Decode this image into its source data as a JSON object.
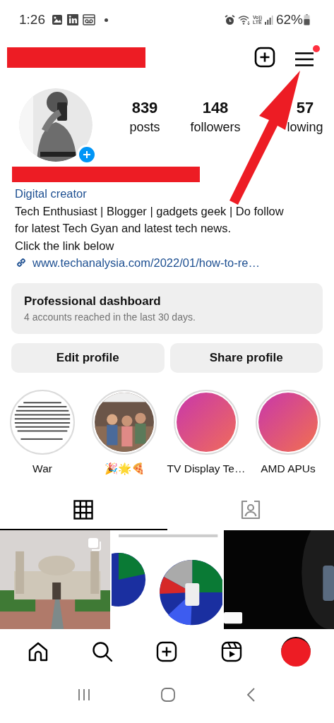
{
  "status_bar": {
    "time": "1:26",
    "network": [
      "Vo))",
      "LTE"
    ],
    "battery": "62%",
    "notification_dot": true
  },
  "header": {
    "menu_badge": true
  },
  "profile": {
    "stats": [
      {
        "value": "839",
        "label": "posts"
      },
      {
        "value": "148",
        "label": "followers"
      },
      {
        "value": "57",
        "label": "lowing"
      }
    ],
    "category": "Digital creator",
    "bio": [
      "Tech Enthusiast | Blogger | gadgets geek | Do follow",
      "for latest Tech Gyan and latest tech news.",
      "Click the link below"
    ],
    "link": "www.techanalysia.com/2022/01/how-to-re…"
  },
  "dashboard": {
    "title": "Professional dashboard",
    "subtitle": "4 accounts reached in the last 30 days."
  },
  "buttons": [
    "Edit profile",
    "Share profile"
  ],
  "highlights": [
    {
      "label": "War"
    },
    {
      "label": "🎉🌟🍕"
    },
    {
      "label": "TV Display Te…"
    },
    {
      "label": "AMD APUs"
    }
  ],
  "tabs": [
    {
      "kind": "grid",
      "selected": true
    },
    {
      "kind": "tagged",
      "selected": false
    }
  ],
  "posts": [
    {
      "kind": "picture",
      "carousel": true
    },
    {
      "kind": "picture",
      "carousel": false
    },
    {
      "kind": "picture",
      "carousel": false
    }
  ],
  "bottom_nav": [
    {
      "kind": "home"
    },
    {
      "kind": "search"
    },
    {
      "kind": "create"
    },
    {
      "kind": "reels"
    },
    {
      "kind": "profile"
    }
  ]
}
